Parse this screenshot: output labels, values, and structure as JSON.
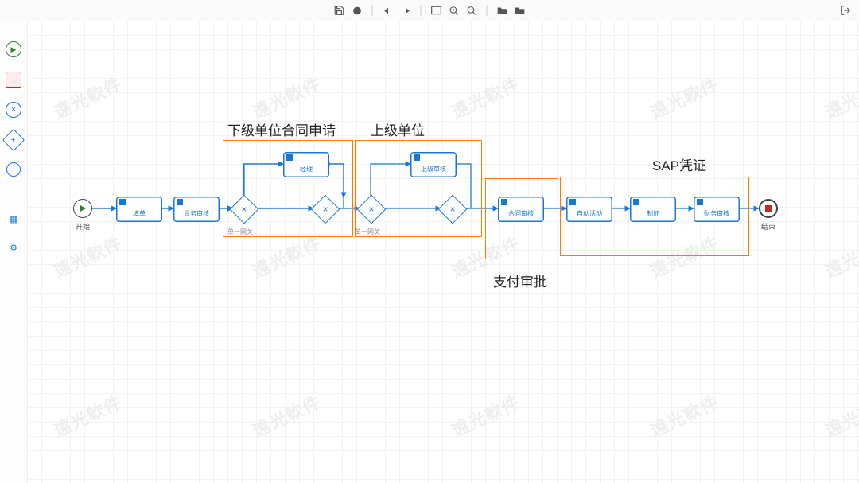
{
  "toolbar": {
    "save": "save",
    "validate": "validate",
    "undo": "undo",
    "redo": "redo",
    "fit": "fit",
    "zoom_in": "zoom_in",
    "zoom_out": "zoom_out",
    "folder_add": "folder_add",
    "folder_new": "folder_new",
    "exit": "exit"
  },
  "palette": {
    "start": "start-event",
    "end": "end-event",
    "cancel": "cancel",
    "plus": "gateway",
    "circle": "intermediate",
    "sheet": "task",
    "gear": "settings"
  },
  "events": {
    "start_label": "开始",
    "end_label": "结束"
  },
  "tasks": {
    "fill_form": "填单",
    "biz_review": "业务审核",
    "manager": "经理",
    "superior_review": "上级审核",
    "contract_review": "合同审核",
    "auto_activity": "自动活动",
    "make_cert": "制证",
    "finance_review": "财务审核"
  },
  "gateways": {
    "single_gw": "单一网关"
  },
  "callouts": {
    "lower_unit_apply": "下级单位合同申请",
    "upper_unit": "上级单位",
    "pay_approve": "支付审批",
    "sap_cert": "SAP凭证"
  },
  "watermark": "遠光軟件"
}
